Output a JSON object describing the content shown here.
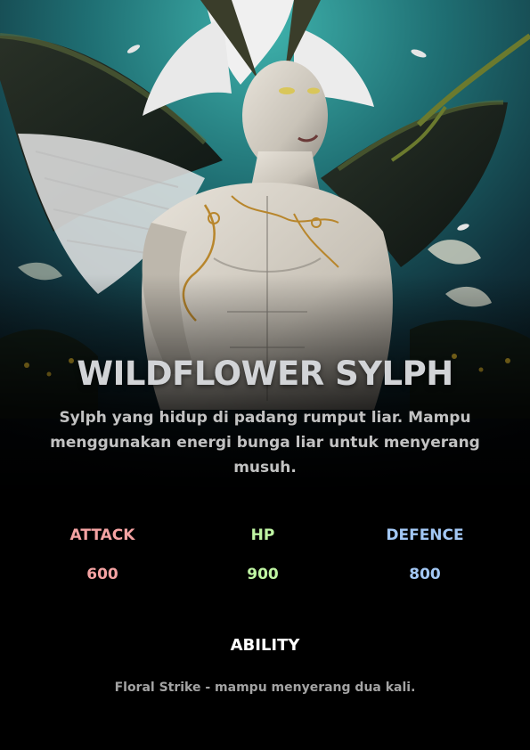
{
  "card": {
    "title": "WILDFLOWER SYLPH",
    "description": "Sylph yang hidup di padang rumput liar. Mampu menggunakan energi bunga liar untuk menyerang musuh.",
    "stats": [
      {
        "label": "ATTACK",
        "value": "600",
        "color": "#f5a3a3"
      },
      {
        "label": "HP",
        "value": "900",
        "color": "#bff5a3"
      },
      {
        "label": "DEFENCE",
        "value": "800",
        "color": "#a3c8f5"
      }
    ],
    "ability": {
      "heading": "ABILITY",
      "text": "Floral Strike - mampu menyerang dua kali."
    }
  },
  "colors": {
    "background": "#000000",
    "title": "#d2d4d7",
    "description": "#c2c2c2",
    "ability_text": "#a3a3a3",
    "sky_teal": "#2f9c9a"
  }
}
